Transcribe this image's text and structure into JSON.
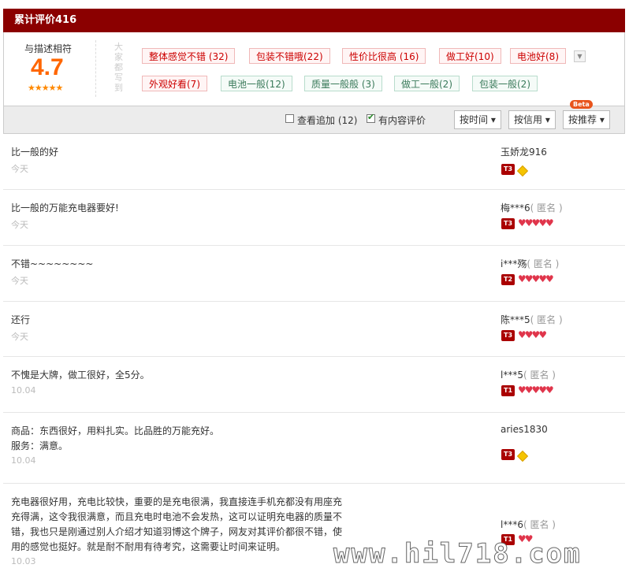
{
  "header": {
    "title": "累计评价416"
  },
  "rating": {
    "label": "与描述相符",
    "score": "4.7",
    "stars": "★★★★★",
    "stars_value": 4.7
  },
  "tags_heading": "大家都写到",
  "tags": [
    {
      "text": "整体感觉不错 (32)",
      "tone": "positive"
    },
    {
      "text": "包装不错哦(22)",
      "tone": "positive"
    },
    {
      "text": "性价比很高 (16)",
      "tone": "positive"
    },
    {
      "text": "做工好(10)",
      "tone": "positive"
    },
    {
      "text": "电池好(8)",
      "tone": "positive"
    },
    {
      "text": "外观好看(7)",
      "tone": "positive"
    },
    {
      "text": "电池一般(12)",
      "tone": "neutral"
    },
    {
      "text": "质量一般般 (3)",
      "tone": "neutral"
    },
    {
      "text": "做工一般(2)",
      "tone": "neutral"
    },
    {
      "text": "包装一般(2)",
      "tone": "neutral"
    }
  ],
  "filters": {
    "show_additional": {
      "label": "查看追加 (12)",
      "checked": false
    },
    "has_content": {
      "label": "有内容评价",
      "checked": true
    }
  },
  "sort": {
    "by_time": "按时间",
    "by_credit": "按信用",
    "by_recommend": "按推荐",
    "beta": "Beta"
  },
  "reviews": [
    {
      "lines": [
        "比一般的好"
      ],
      "date": "今天",
      "user": "玉娇龙916",
      "anon": "",
      "level": "T3",
      "rank": "diamond",
      "count": 1
    },
    {
      "lines": [
        "比一般的万能充电器要好!"
      ],
      "date": "今天",
      "user": "梅***6",
      "anon": "( 匿名 )",
      "level": "T3",
      "rank": "heart",
      "count": 5
    },
    {
      "lines": [
        "不错~~~~~~~~"
      ],
      "date": "今天",
      "user": "i***殇",
      "anon": "( 匿名 )",
      "level": "T2",
      "rank": "heart",
      "count": 5
    },
    {
      "lines": [
        "还行"
      ],
      "date": "今天",
      "user": "陈***5",
      "anon": "( 匿名 )",
      "level": "T3",
      "rank": "heart",
      "count": 4
    },
    {
      "lines": [
        "不愧是大牌，做工很好，全5分。"
      ],
      "date": "10.04",
      "user": "l***5",
      "anon": "( 匿名 )",
      "level": "T1",
      "rank": "heart",
      "count": 5
    },
    {
      "lines": [
        "商品：东西很好，用料扎实。比品胜的万能充好。",
        "服务：满意。"
      ],
      "date": "10.04",
      "user": "aries1830",
      "anon": "",
      "level": "T3",
      "rank": "diamond",
      "count": 1
    },
    {
      "lines": [
        "充电器很好用，充电比较快，重要的是充电很满，我直接连手机充都没有用座充",
        "充得满，这令我很满意，而且充电时电池不会发热，这可以证明充电器的质量不",
        "错，我也只是刚通过别人介绍才知道羽博这个牌子，网友对其评价都很不错，使",
        "用的感觉也挺好。就是耐不耐用有待考究，这需要让时间来证明。"
      ],
      "date": "10.03",
      "user": "l***6",
      "anon": "( 匿名 )",
      "level": "T1",
      "rank": "heart",
      "count": 2
    }
  ],
  "watermark": "www.hil718.com"
}
